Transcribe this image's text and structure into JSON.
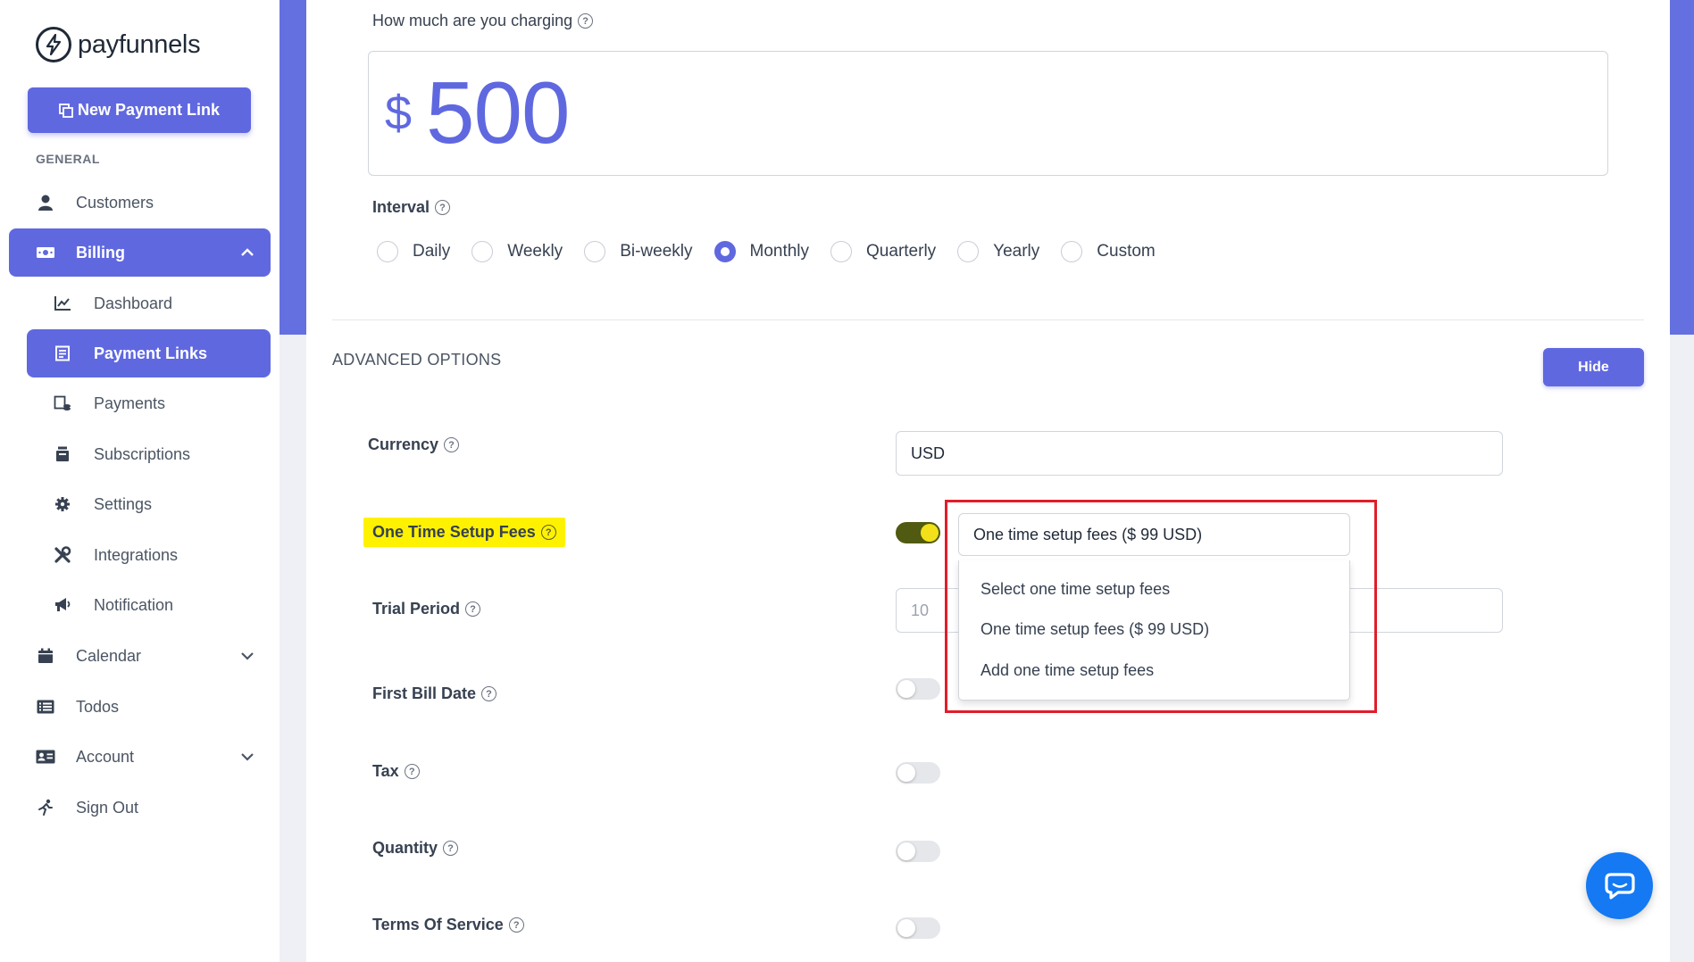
{
  "brand": {
    "name": "payfunnels"
  },
  "sidebar": {
    "new_link_label": "New Payment Link",
    "section_general": "GENERAL",
    "customers": "Customers",
    "billing": "Billing",
    "dashboard": "Dashboard",
    "payment_links": "Payment Links",
    "payments": "Payments",
    "subscriptions": "Subscriptions",
    "settings": "Settings",
    "integrations": "Integrations",
    "notification": "Notification",
    "calendar": "Calendar",
    "todos": "Todos",
    "account": "Account",
    "sign_out": "Sign Out"
  },
  "form": {
    "charging_label": "How much are you charging",
    "currency_symbol": "$",
    "amount": "500",
    "interval_label": "Interval",
    "interval_options": [
      "Daily",
      "Weekly",
      "Bi-weekly",
      "Monthly",
      "Quarterly",
      "Yearly",
      "Custom"
    ],
    "interval_selected": "Monthly"
  },
  "advanced": {
    "title": "ADVANCED OPTIONS",
    "hide_label": "Hide",
    "currency_label": "Currency",
    "currency_value": "USD",
    "setup_fees_label": "One Time Setup Fees",
    "setup_fees_value": "One time setup fees ($ 99 USD)",
    "setup_fees_options": [
      "Select one time setup fees",
      "One time setup fees ($ 99 USD)",
      "Add one time setup fees"
    ],
    "trial_label": "Trial Period",
    "trial_placeholder": "10",
    "first_bill_label": "First Bill Date",
    "tax_label": "Tax",
    "quantity_label": "Quantity",
    "terms_label": "Terms Of Service"
  },
  "colors": {
    "accent": "#6068e0",
    "highlight": "#fff200",
    "annotation": "#e11d2a",
    "chat": "#1479f2"
  }
}
